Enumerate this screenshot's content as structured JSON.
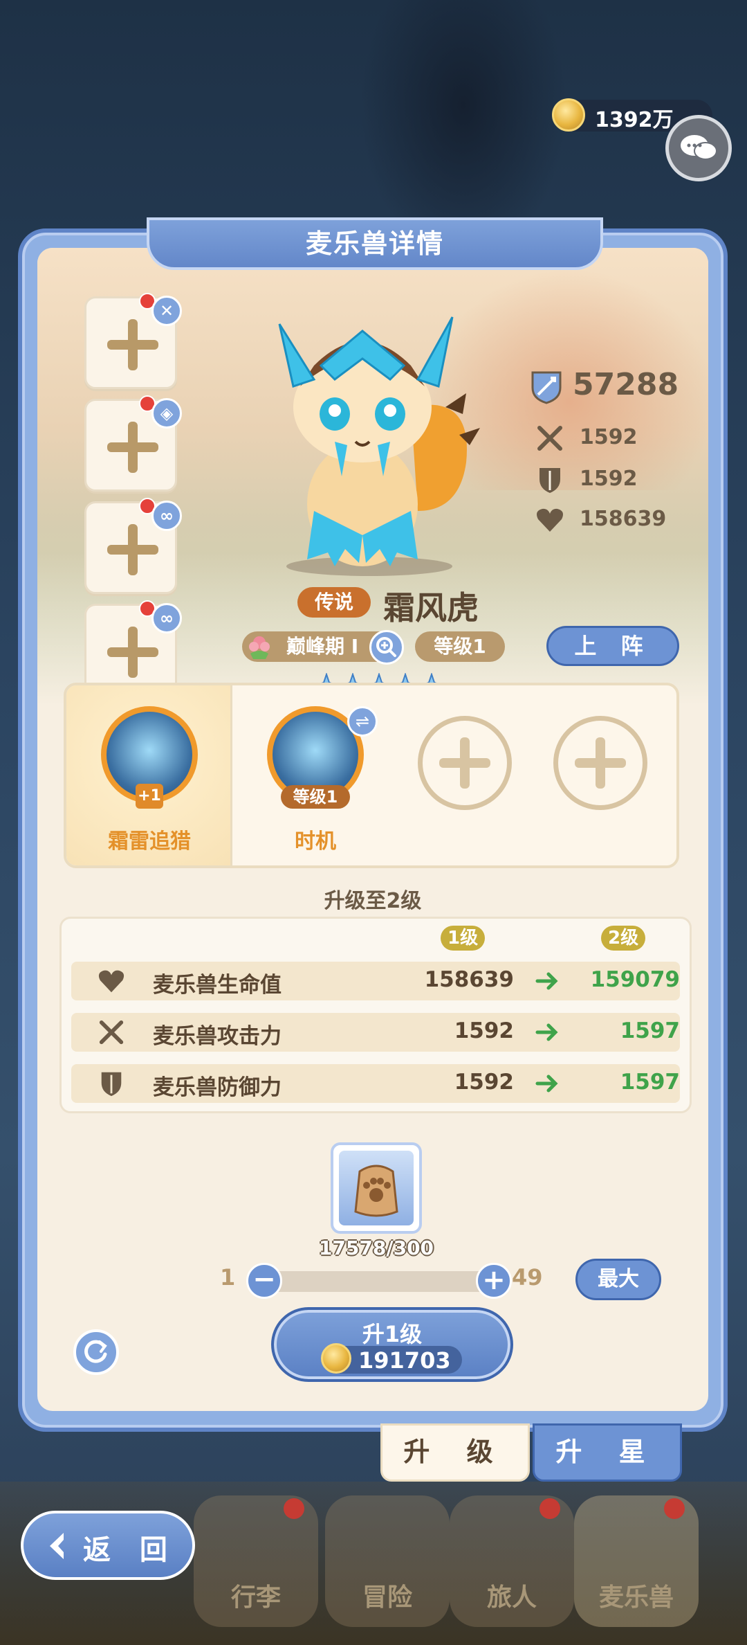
{
  "header": {
    "coins": "1392万"
  },
  "dialog": {
    "title": "麦乐兽详情"
  },
  "pet": {
    "power": "57288",
    "attack": "1592",
    "defense": "1592",
    "hp": "158639",
    "rarity": "传说",
    "name": "霜风虎",
    "stage": "巅峰期 Ⅰ",
    "level": "等级1",
    "deploy_label": "上 阵",
    "stars": 5
  },
  "skills": [
    {
      "name": "霜雷追猎",
      "badge": "+1"
    },
    {
      "name": "时机",
      "badge": "等级1"
    }
  ],
  "upgrade": {
    "title": "升级至2级",
    "from_level": "1级",
    "to_level": "2级",
    "rows": [
      {
        "label": "麦乐兽生命值",
        "current": "158639",
        "next": "159079",
        "icon": "heart-icon"
      },
      {
        "label": "麦乐兽攻击力",
        "current": "1592",
        "next": "1597",
        "icon": "swords-icon"
      },
      {
        "label": "麦乐兽防御力",
        "current": "1592",
        "next": "1597",
        "icon": "shield-icon"
      }
    ],
    "material_count": "17578/300",
    "slider_min": "1",
    "slider_max": "49",
    "max_label": "最大",
    "button_label": "升1级",
    "cost": "191703"
  },
  "tabs": {
    "upgrade": "升 级",
    "star": "升 星"
  },
  "nav": {
    "back": "返 回",
    "items": [
      "行李",
      "冒险",
      "旅人",
      "麦乐兽"
    ]
  },
  "colors": {
    "accent": "#6d93d4",
    "gold": "#e8b640",
    "green": "#3fa34a",
    "rarity": "#c9702d"
  }
}
